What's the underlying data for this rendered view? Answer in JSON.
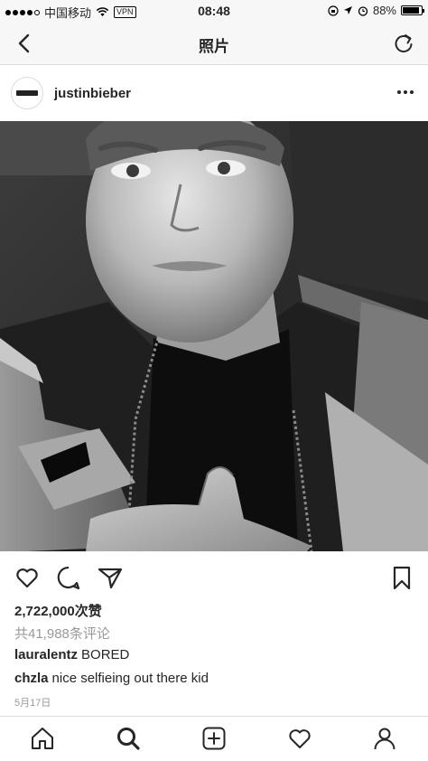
{
  "status_bar": {
    "carrier": "中国移动",
    "vpn": "VPN",
    "time": "08:48",
    "battery": "88%",
    "battery_level": 0.88
  },
  "nav": {
    "title": "照片",
    "back_icon": "chevron-left-icon",
    "refresh_icon": "refresh-icon"
  },
  "post": {
    "username": "justinbieber",
    "photo_description_icon": "photo",
    "likes": "2,722,000次赞",
    "comment_count": "共41,988条评论",
    "comments": [
      {
        "user": "lauralentz",
        "text": "BORED"
      },
      {
        "user": "chzla",
        "text": "nice selfieing out there kid"
      }
    ],
    "date": "5月17日"
  },
  "actions": [
    "heart-icon",
    "comment-icon",
    "share-icon",
    "bookmark-icon"
  ],
  "tabs": [
    "home-icon",
    "search-icon",
    "add-icon",
    "activity-icon",
    "profile-icon"
  ],
  "colors": {
    "text": "#262626",
    "muted": "#999999",
    "bar": "#f7f7f7",
    "divider": "#dbdbdb"
  }
}
